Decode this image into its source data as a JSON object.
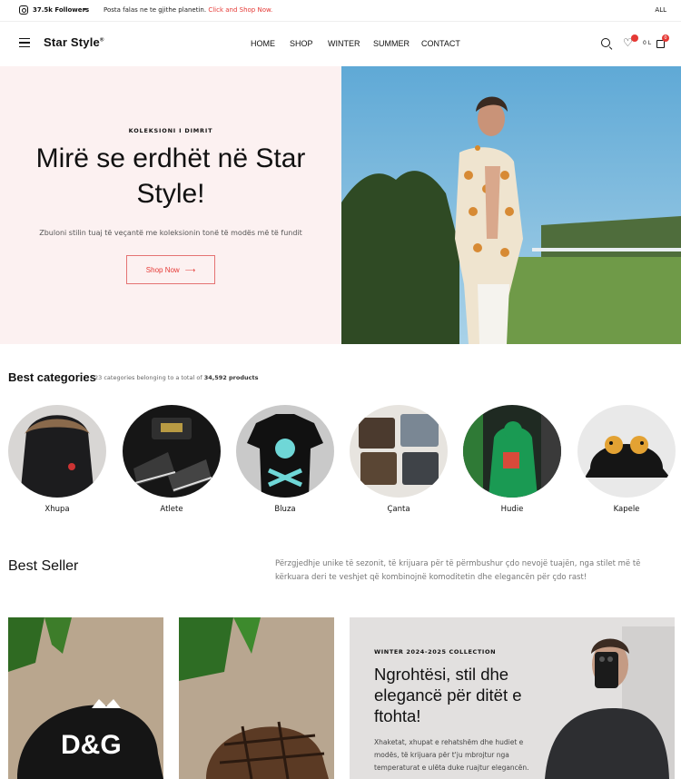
{
  "topbar": {
    "followers": "37.5k Followers",
    "promo_text": "Posta falas ne te gjithe planetin.",
    "promo_link": "Click and Shop Now.",
    "lang": "ALL"
  },
  "header": {
    "logo": "Star Style",
    "logo_mark": "®",
    "nav": [
      "HOME",
      "SHOP",
      "WINTER",
      "SUMMER",
      "CONTACT"
    ],
    "cart_total": "0 L",
    "cart_count": "0"
  },
  "hero": {
    "eyebrow": "KOLEKSIONI I DIMRIT",
    "title": "Mirë se erdhët në Star Style!",
    "description": "Zbuloni stilin tuaj të veçantë me koleksionin tonë të modës më të fundit",
    "button": "Shop Now"
  },
  "categories": {
    "title": "Best categories",
    "count": "23 categories",
    "meta_mid": "belonging to a total of",
    "products": "34,592 products",
    "items": [
      {
        "label": "Xhupa"
      },
      {
        "label": "Atlete"
      },
      {
        "label": "Bluza"
      },
      {
        "label": "Çanta"
      },
      {
        "label": "Hudie"
      },
      {
        "label": "Kapele"
      }
    ]
  },
  "best_seller": {
    "title": "Best Seller",
    "description": "Përzgjedhje unike të sezonit, të krijuara për të përmbushur çdo nevojë tuajën, nga stilet më të kërkuara deri te veshjet që kombinojnë komoditetin dhe elegancën për çdo rast!",
    "product_text": "D&G",
    "promo": {
      "eyebrow": "WINTER 2024-2025 COLLECTION",
      "title": "Ngrohtësi, stil dhe elegancë për ditët e ftohta!",
      "text": "Xhaketat, xhupat e rehatshëm dhe hudiet e modës, të krijuara për t'ju mbrojtur nga temperaturat e ulëta duke ruajtur elegancën."
    }
  },
  "colors": {
    "accent": "#e53935",
    "hero_bg": "#fcf1f1"
  }
}
